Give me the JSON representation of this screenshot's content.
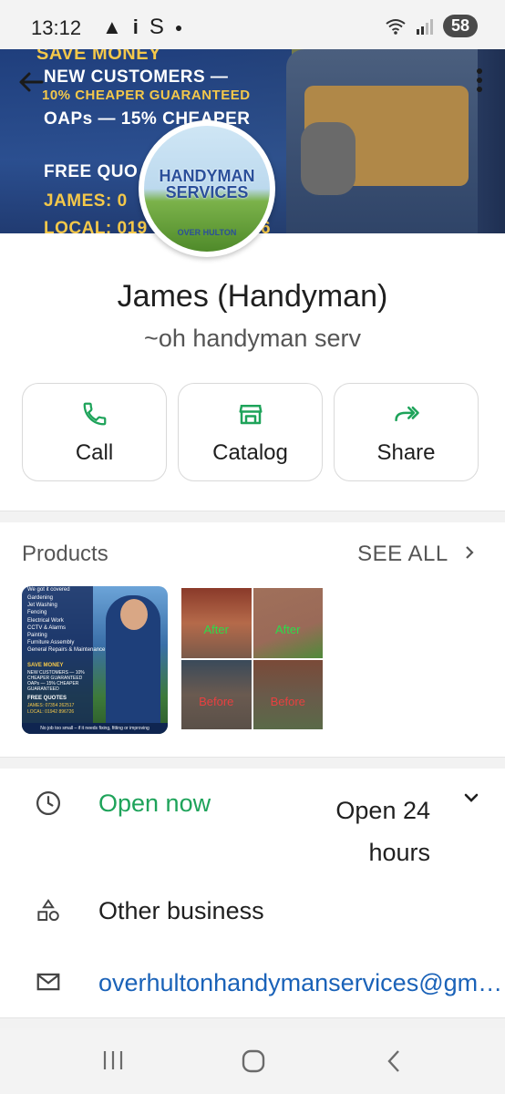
{
  "status_bar": {
    "time": "13:12",
    "left_icons": [
      "warning-icon",
      "info-icon",
      "s-icon",
      "dot-icon"
    ],
    "battery": "58"
  },
  "cover": {
    "line1": "SAVE MONEY",
    "line2": "NEW CUSTOMERS —",
    "line3": "10% CHEAPER GUARANTEED",
    "line4": "OAPs — 15% CHEAPER",
    "line5": "FREE QUO",
    "line6": "JAMES: 0",
    "line7": "LOCAL: 019",
    "line8": "6"
  },
  "logo": {
    "title": "HANDYMAN SERVICES",
    "subtitle": "OVER HULTON"
  },
  "business": {
    "name": "James (Handyman)",
    "tagline": "~oh handyman serv"
  },
  "actions": [
    {
      "label": "Call",
      "icon": "phone-icon"
    },
    {
      "label": "Catalog",
      "icon": "storefront-icon"
    },
    {
      "label": "Share",
      "icon": "forward-icon"
    }
  ],
  "products": {
    "title": "Products",
    "see_all": "SEE ALL",
    "item1": {
      "header": "We got it covered",
      "services": [
        "Gardening",
        "Jet Washing",
        "Fencing",
        "Electrical Work",
        "CCTV & Alarms",
        "Painting",
        "Furniture Assembly",
        "General Repairs & Maintenance"
      ],
      "promo": "SAVE MONEY",
      "promo_lines": [
        "NEW CUSTOMERS — 10% CHEAPER GUARANTEED",
        "OAPs — 15% CHEAPER GUARANTEED"
      ],
      "quotes": "FREE QUOTES",
      "phone1": "JAMES: 07354 262517",
      "phone2": "LOCAL: 01942 896726",
      "footer": "No job too small – if it needs fixing, fitting or improving"
    },
    "item2": {
      "tiles": [
        "After",
        "After",
        "Before",
        "Before"
      ]
    }
  },
  "info": {
    "status": "Open now",
    "hours_line1": "Open 24",
    "hours_line2": "hours",
    "category": "Other business",
    "email": "overhultonhandymanservices@gmail.com"
  },
  "colors": {
    "accent_green": "#1ea35a",
    "link_blue": "#1a62b8"
  }
}
